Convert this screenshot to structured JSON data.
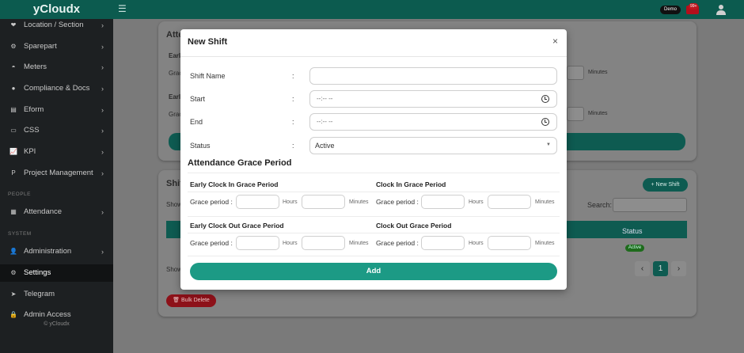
{
  "app": {
    "brand": "yCloudx",
    "demo_badge": "Demo",
    "notif_count": "99+",
    "footer": "© yCloudx"
  },
  "sidebar": {
    "items": [
      {
        "label": "Location / Section"
      },
      {
        "label": "Sparepart"
      },
      {
        "label": "Meters"
      },
      {
        "label": "Compliance & Docs"
      },
      {
        "label": "Eform"
      },
      {
        "label": "CSS"
      },
      {
        "label": "KPI"
      },
      {
        "label": "Project Management"
      }
    ],
    "people_header": "PEOPLE",
    "people_items": [
      {
        "label": "Attendance"
      }
    ],
    "system_header": "SYSTEM",
    "system_items": [
      {
        "label": "Administration"
      },
      {
        "label": "Settings"
      },
      {
        "label": "Telegram"
      },
      {
        "label": "Admin Access"
      }
    ]
  },
  "background": {
    "card1_title": "Atte",
    "card1_row1": "Earl",
    "card1_row2": "Grac",
    "card1_row3": "Earl",
    "card1_row4": "Grac",
    "card1_minutes1": "Minutes",
    "card1_minutes2": "Minutes",
    "card2_title": "Shif",
    "show_label": "Show",
    "show_label2": "Show",
    "search_label": "Search:",
    "new_shift_btn": "+ New Shift",
    "status_header": "Status",
    "active_pill": "Active",
    "page_current": "1",
    "bulk_delete": "Bulk Delete"
  },
  "modal": {
    "title": "New Shift",
    "close": "×",
    "fields": {
      "shift_name_label": "Shift Name",
      "start_label": "Start",
      "end_label": "End",
      "status_label": "Status",
      "colon": ":",
      "start_placeholder": "--:-- --",
      "end_placeholder": "--:-- --",
      "status_value": "Active"
    },
    "section_title": "Attendance Grace Period",
    "early_clock_in": "Early Clock In Grace Period",
    "clock_in": "Clock In Grace Period",
    "early_clock_out": "Early Clock Out Grace Period",
    "clock_out": "Clock Out Grace Period",
    "grace_label": "Grace period :",
    "hours": "Hours",
    "minutes": "Minutes",
    "add_button": "Add"
  }
}
